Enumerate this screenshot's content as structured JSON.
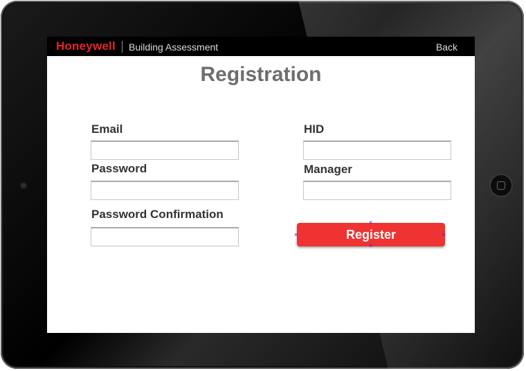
{
  "app": {
    "brand": "Honeywell",
    "title": "Building Assessment",
    "back_label": "Back"
  },
  "page": {
    "title": "Registration"
  },
  "form": {
    "email_label": "Email",
    "email_value": "",
    "password_label": "Password",
    "password_value": "",
    "password_confirmation_label": "Password Confirmation",
    "password_confirmation_value": "",
    "hid_label": "HID",
    "hid_value": "",
    "manager_label": "Manager",
    "manager_value": "",
    "register_label": "Register"
  },
  "colors": {
    "brand_red": "#e4262b",
    "register_button": "#ee3332",
    "title_gray": "#6e6e6e",
    "topbar": "#000000"
  },
  "icons": {
    "home_button": "home-button-icon",
    "camera": "camera-icon",
    "selection_handle": "x-mark"
  }
}
